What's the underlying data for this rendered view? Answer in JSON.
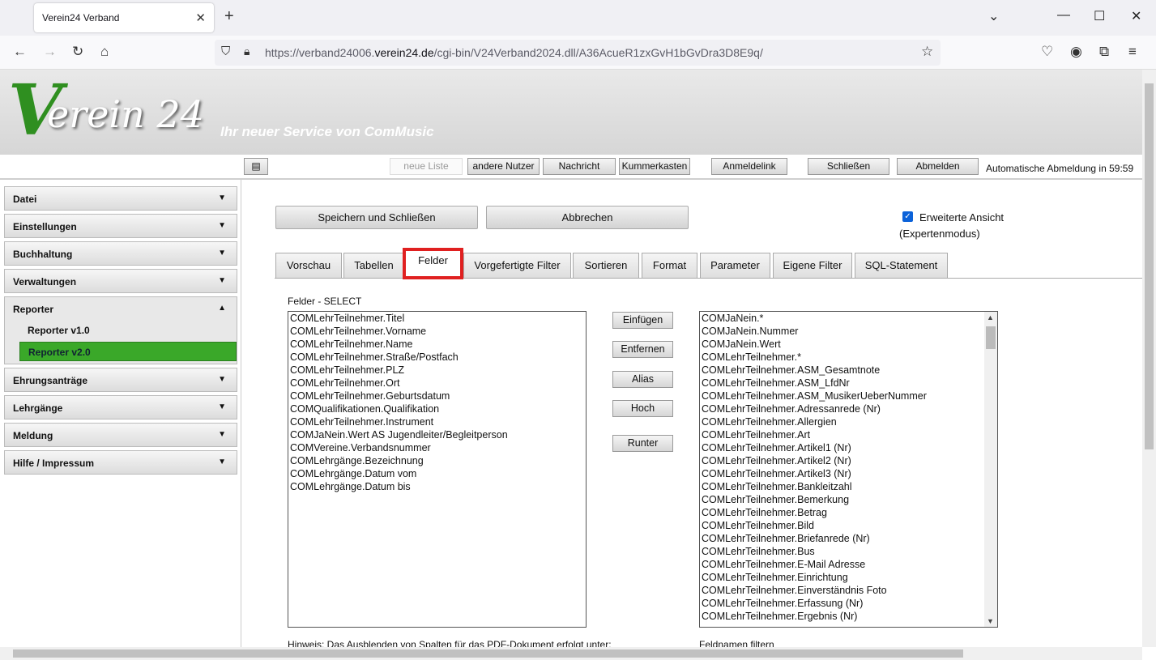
{
  "browser": {
    "tab_title": "Verein24 Verband",
    "url_prefix": "https://verband24006.",
    "url_domain": "verein24.de",
    "url_suffix": "/cgi-bin/V24Verband2024.dll/A36AcueR1zxGvH1bGvDra3D8E9q/"
  },
  "header": {
    "logo_v": "V",
    "logo_rest": "erein 24",
    "tagline": "Ihr neuer Service von ComMusic"
  },
  "toolbar": {
    "neue_liste": "neue Liste",
    "andere_nutzer": "andere Nutzer",
    "nachricht": "Nachricht",
    "kummerkasten": "Kummerkasten",
    "anmeldelink": "Anmeldelink",
    "schliessen": "Schließen",
    "abmelden": "Abmelden",
    "auto_logout": "Automatische Abmeldung in 59:59"
  },
  "sidebar": {
    "items": [
      {
        "label": "Datei"
      },
      {
        "label": "Einstellungen"
      },
      {
        "label": "Buchhaltung"
      },
      {
        "label": "Verwaltungen"
      },
      {
        "label": "Reporter"
      },
      {
        "label": "Ehrungsanträge"
      },
      {
        "label": "Lehrgänge"
      },
      {
        "label": "Meldung"
      },
      {
        "label": "Hilfe / Impressum"
      }
    ],
    "reporter_sub": [
      {
        "label": "Reporter v1.0"
      },
      {
        "label": "Reporter v2.0"
      }
    ]
  },
  "main": {
    "save_close": "Speichern und Schließen",
    "cancel": "Abbrechen",
    "expert_view": "Erweiterte Ansicht",
    "expert_mode": "(Expertenmodus)",
    "expert_checked": true,
    "tabs": [
      "Vorschau",
      "Tabellen",
      "Felder",
      "Vorgefertigte Filter",
      "Sortieren",
      "Format",
      "Parameter",
      "Eigene Filter",
      "SQL-Statement"
    ],
    "active_tab": "Felder",
    "section_label": "Felder - SELECT",
    "selected_fields": [
      "COMLehrTeilnehmer.Titel",
      "COMLehrTeilnehmer.Vorname",
      "COMLehrTeilnehmer.Name",
      "COMLehrTeilnehmer.Straße/Postfach",
      "COMLehrTeilnehmer.PLZ",
      "COMLehrTeilnehmer.Ort",
      "COMLehrTeilnehmer.Geburtsdatum",
      "COMQualifikationen.Qualifikation",
      "COMLehrTeilnehmer.Instrument",
      "COMJaNein.Wert AS Jugendleiter/Begleitperson",
      "COMVereine.Verbandsnummer",
      "COMLehrgänge.Bezeichnung",
      "COMLehrgänge.Datum vom",
      "COMLehrgänge.Datum bis"
    ],
    "buttons": {
      "einfuegen": "Einfügen",
      "entfernen": "Entfernen",
      "alias": "Alias",
      "hoch": "Hoch",
      "runter": "Runter"
    },
    "available_fields": [
      "COMJaNein.*",
      "COMJaNein.Nummer",
      "COMJaNein.Wert",
      "COMLehrTeilnehmer.*",
      "COMLehrTeilnehmer.ASM_Gesamtnote",
      "COMLehrTeilnehmer.ASM_LfdNr",
      "COMLehrTeilnehmer.ASM_MusikerUeberNummer",
      "COMLehrTeilnehmer.Adressanrede (Nr)",
      "COMLehrTeilnehmer.Allergien",
      "COMLehrTeilnehmer.Art",
      "COMLehrTeilnehmer.Artikel1 (Nr)",
      "COMLehrTeilnehmer.Artikel2 (Nr)",
      "COMLehrTeilnehmer.Artikel3 (Nr)",
      "COMLehrTeilnehmer.Bankleitzahl",
      "COMLehrTeilnehmer.Bemerkung",
      "COMLehrTeilnehmer.Betrag",
      "COMLehrTeilnehmer.Bild",
      "COMLehrTeilnehmer.Briefanrede (Nr)",
      "COMLehrTeilnehmer.Bus",
      "COMLehrTeilnehmer.E-Mail Adresse",
      "COMLehrTeilnehmer.Einrichtung",
      "COMLehrTeilnehmer.Einverständnis Foto",
      "COMLehrTeilnehmer.Erfassung (Nr)",
      "COMLehrTeilnehmer.Ergebnis (Nr)"
    ],
    "hint_left": "Hinweis: Das Ausblenden von Spalten für das PDF-Dokument erfolgt unter:",
    "hint_right": "Feldnamen filtern"
  },
  "colors": {
    "accent_green": "#3aa829",
    "highlight_red": "#e02020",
    "checkbox_blue": "#0b62d9"
  }
}
